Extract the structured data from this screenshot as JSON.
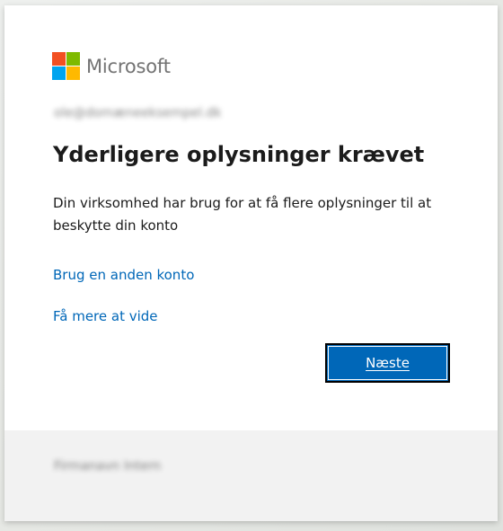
{
  "brand": {
    "name": "Microsoft",
    "colors": [
      "#f25022",
      "#7fba00",
      "#00a4ef",
      "#ffb900"
    ]
  },
  "account": {
    "email": "ole@domæneeksempel.dk"
  },
  "content": {
    "title": "Yderligere oplysninger krævet",
    "description": "Din virksomhed har brug for at få flere oplysninger til at beskytte din konto",
    "link_other_account": "Brug en anden konto",
    "link_learn_more": "Få mere at vide",
    "next_button": "Næste"
  },
  "footer": {
    "org_name": "Firmanavn Intern"
  },
  "colors": {
    "accent": "#0067b8",
    "link": "#0067b8",
    "text": "#1b1b1b",
    "footer_bg": "#f2f2f2"
  }
}
